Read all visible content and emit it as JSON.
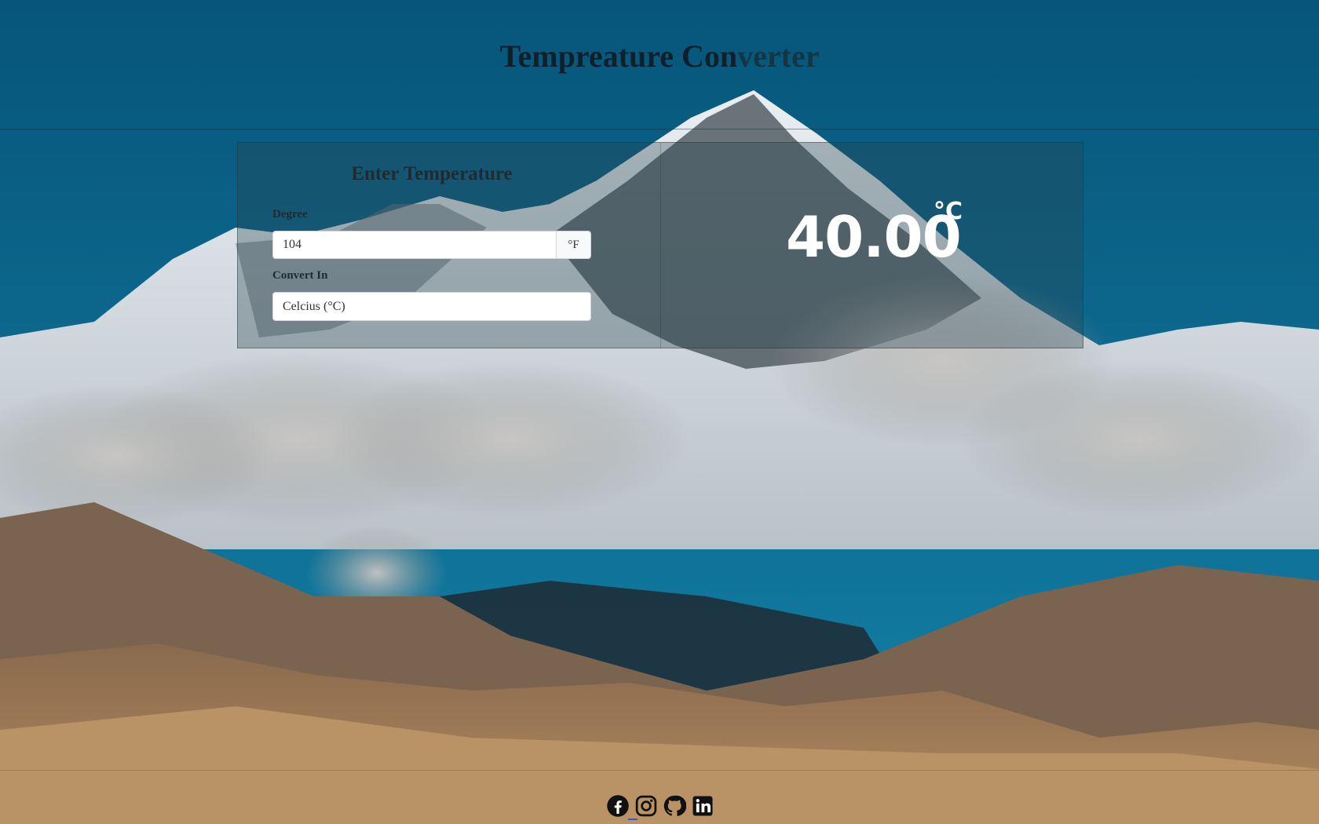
{
  "header": {
    "title_main": "Tempreature Con",
    "title_fade": "verter"
  },
  "converter": {
    "heading": "Enter Temperature",
    "degree_label": "Degree",
    "degree_value": "104",
    "degree_unit": "°F",
    "convert_label": "Convert In",
    "convert_selected": "Celcius (°C)",
    "result_value": "40.00",
    "result_unit": "°C"
  },
  "footer": {
    "social": [
      "facebook-icon",
      "instagram-icon",
      "github-icon",
      "linkedin-icon"
    ]
  },
  "colors": {
    "sky": "#0d6a8f",
    "panel": "rgba(40,70,80,0.35)",
    "result_text": "#ffffff",
    "active_indicator": "#2a5bd7"
  }
}
